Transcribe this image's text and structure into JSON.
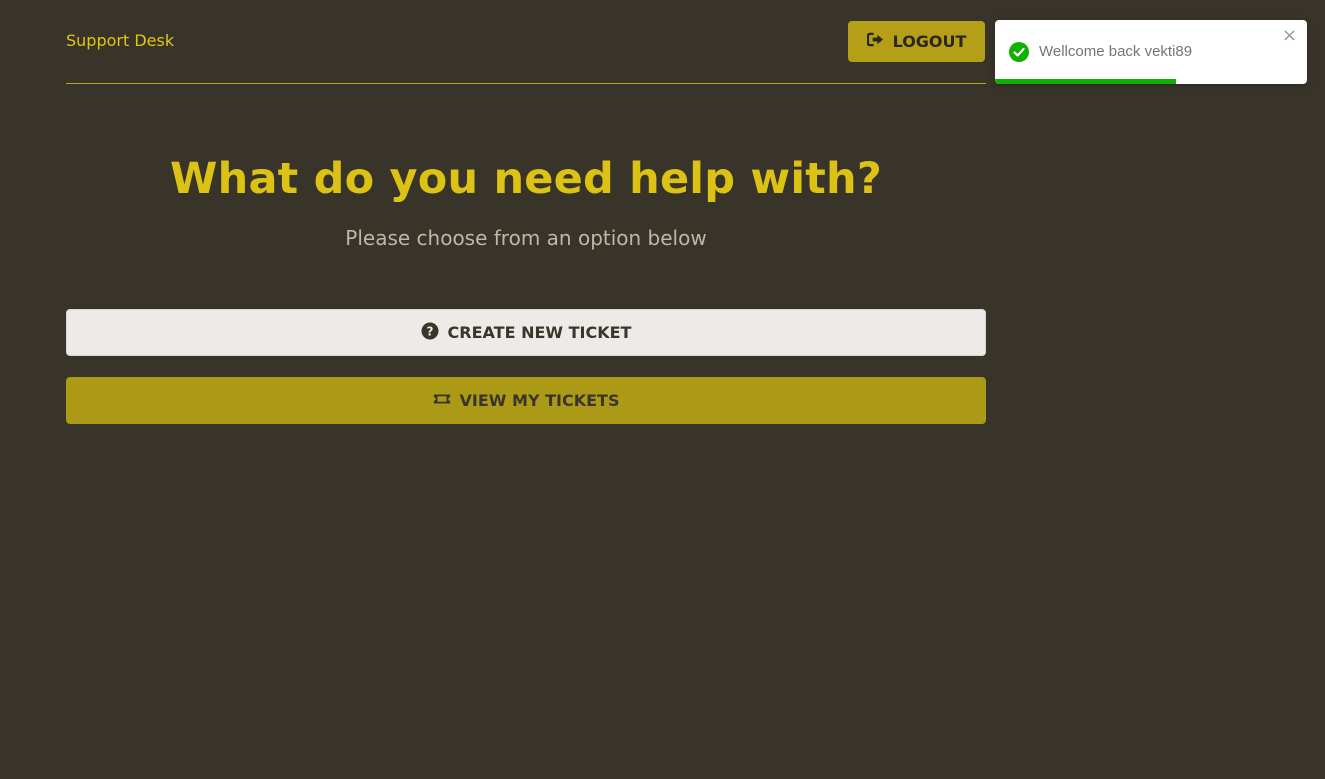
{
  "header": {
    "brand": "Support Desk",
    "logout_label": "LOGOUT",
    "logout_icon": "sign-out-icon"
  },
  "hero": {
    "title": "What do you need help with?",
    "subtitle": "Please choose from an option below"
  },
  "actions": {
    "create_label": "CREATE NEW TICKET",
    "create_icon": "question-circle-icon",
    "view_label": "VIEW MY TICKETS",
    "view_icon": "ticket-icon"
  },
  "toast": {
    "message": "Wellcome back vekti89",
    "type": "success",
    "icon": "check-circle-icon",
    "close_symbol": "×",
    "progress": 0.58
  },
  "colors": {
    "background": "#39342a",
    "accent": "#dcc214",
    "button_primary": "#b59f16",
    "success": "#0fb100"
  }
}
